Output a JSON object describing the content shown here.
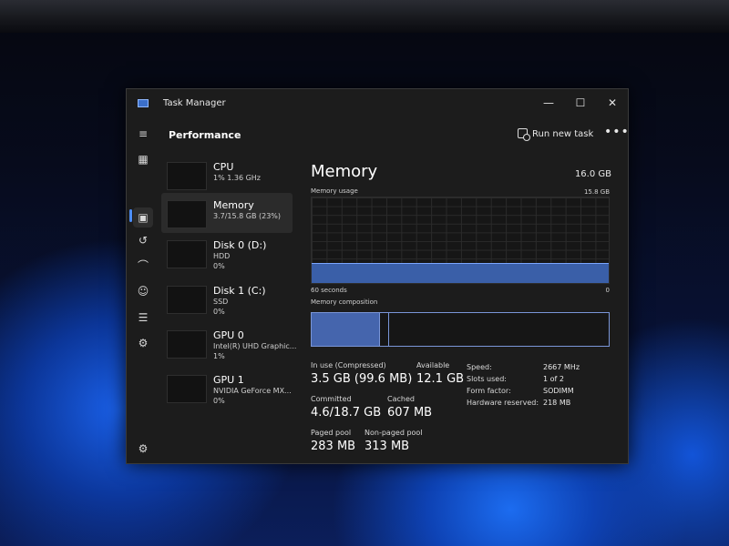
{
  "window": {
    "title": "Task Manager",
    "minimize": "—",
    "maximize": "☐",
    "close": "✕"
  },
  "header": {
    "title": "Performance",
    "run_new_task": "Run new task",
    "more": "•••"
  },
  "sidebar": {
    "items": [
      {
        "name": "hamburger-icon",
        "glyph": "≡"
      },
      {
        "name": "processes-icon",
        "glyph": "▦"
      },
      {
        "name": "performance-icon",
        "glyph": "▣"
      },
      {
        "name": "app-history-icon",
        "glyph": "↺"
      },
      {
        "name": "startup-apps-icon",
        "glyph": "⌒"
      },
      {
        "name": "users-icon",
        "glyph": "☺"
      },
      {
        "name": "details-icon",
        "glyph": "☰"
      },
      {
        "name": "services-icon",
        "glyph": "⚙"
      }
    ],
    "settings_glyph": "⚙"
  },
  "devices": [
    {
      "name": "CPU",
      "line1": "1%  1.36 GHz",
      "line2": "",
      "usage": 0.01
    },
    {
      "name": "Memory",
      "line1": "3.7/15.8 GB (23%)",
      "line2": "",
      "usage": 0.23
    },
    {
      "name": "Disk 0 (D:)",
      "line1": "HDD",
      "line2": "0%",
      "usage": 0.0
    },
    {
      "name": "Disk 1 (C:)",
      "line1": "SSD",
      "line2": "0%",
      "usage": 0.0
    },
    {
      "name": "GPU 0",
      "line1": "Intel(R) UHD Graphic...",
      "line2": "1%",
      "usage": 0.01
    },
    {
      "name": "GPU 1",
      "line1": "NVIDIA GeForce MX...",
      "line2": "0%",
      "usage": 0.0
    }
  ],
  "memory": {
    "title": "Memory",
    "total": "16.0 GB",
    "usage_label": "Memory usage",
    "usage_max": "15.8 GB",
    "time_label": "60 seconds",
    "time_end": "0",
    "usage_fraction": 0.23,
    "composition_label": "Memory composition",
    "composition_in_use_fraction": 0.23,
    "stats": {
      "in_use_label": "In use (Compressed)",
      "in_use_value": "3.5 GB (99.6 MB)",
      "available_label": "Available",
      "available_value": "12.1 GB",
      "committed_label": "Committed",
      "committed_value": "4.6/18.7 GB",
      "cached_label": "Cached",
      "cached_value": "607 MB",
      "paged_label": "Paged pool",
      "paged_value": "283 MB",
      "nonpaged_label": "Non-paged pool",
      "nonpaged_value": "313 MB"
    },
    "details": {
      "speed_label": "Speed:",
      "speed_value": "2667 MHz",
      "slots_label": "Slots used:",
      "slots_value": "1 of 2",
      "form_label": "Form factor:",
      "form_value": "SODIMM",
      "reserved_label": "Hardware reserved:",
      "reserved_value": "218 MB"
    }
  },
  "colors": {
    "accent": "#4c8dfc",
    "graph_fill": "#3a5fa8",
    "window_bg": "#1c1c1c"
  }
}
